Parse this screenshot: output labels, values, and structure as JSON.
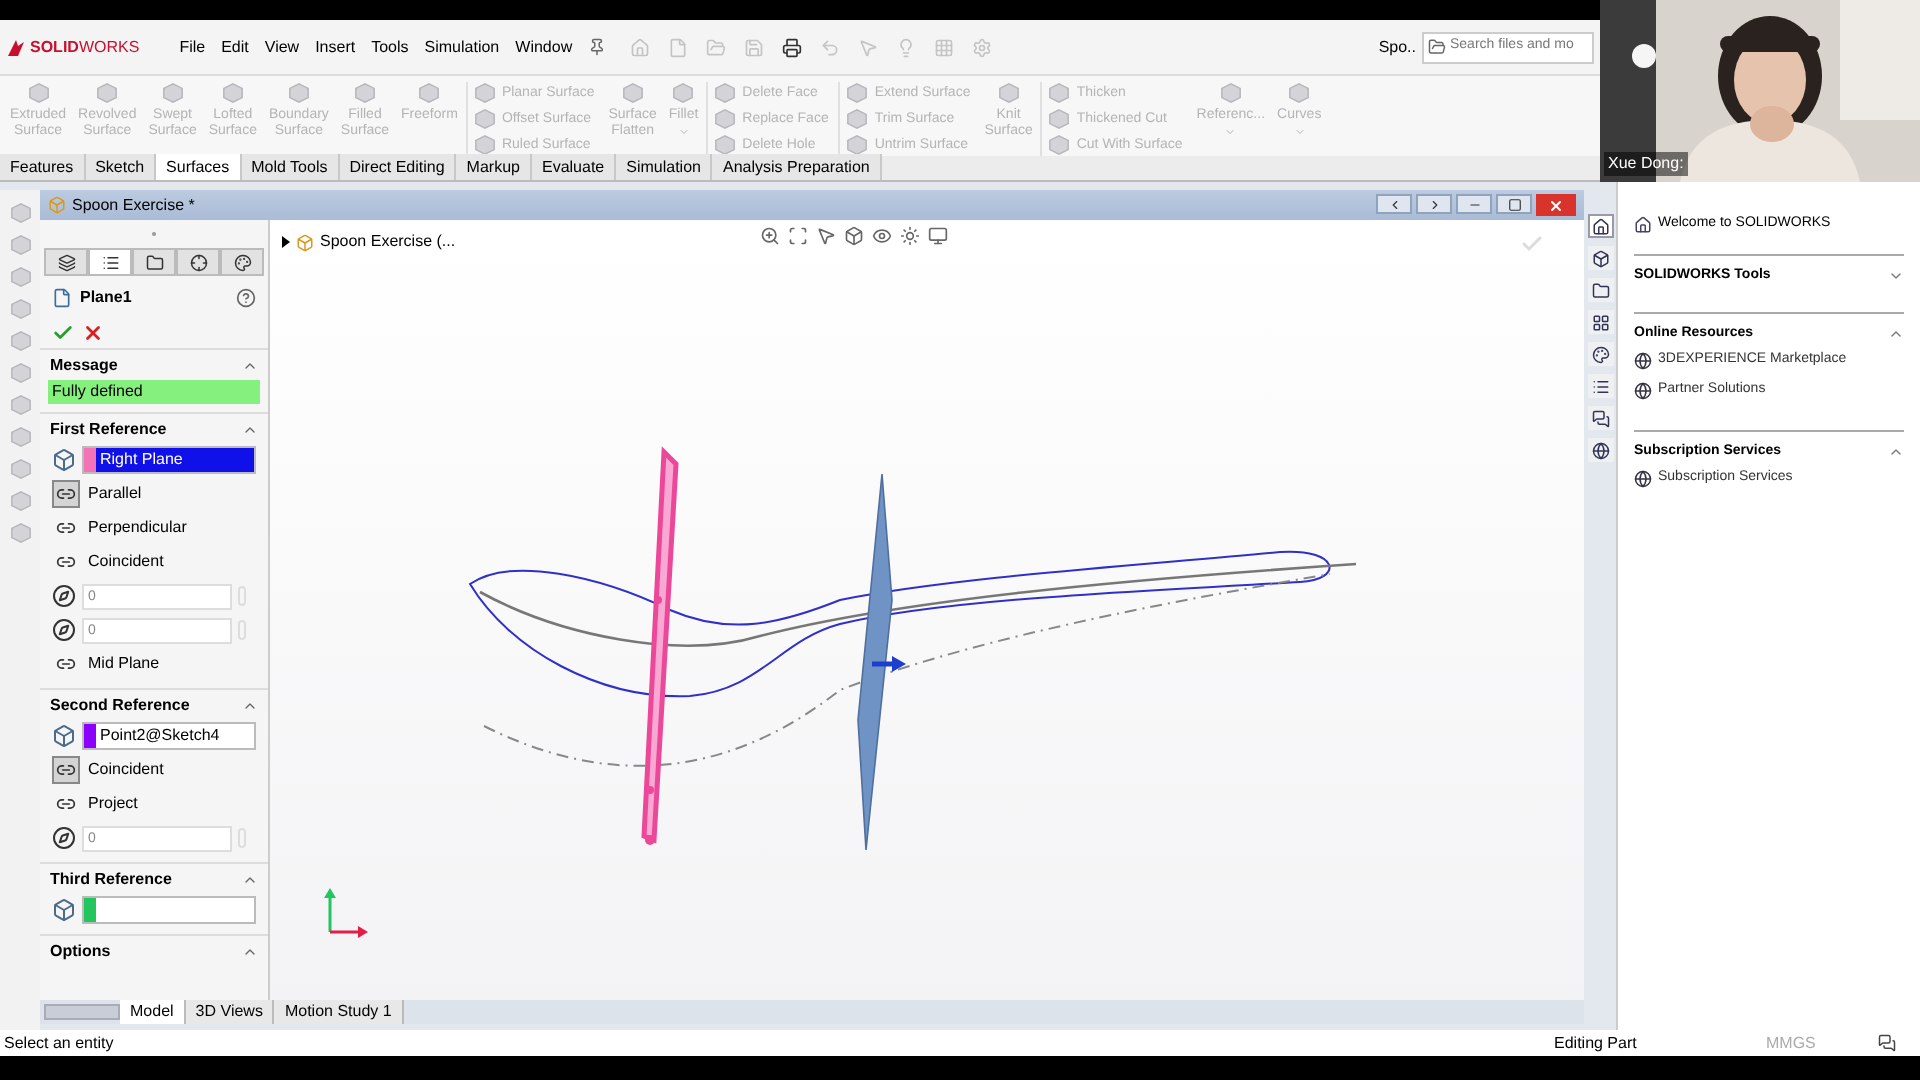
{
  "app": {
    "logo": "**SOLID**WORKS",
    "menu": [
      "File",
      "Edit",
      "View",
      "Insert",
      "Tools",
      "Simulation",
      "Window"
    ],
    "document_short": "Spo..",
    "search": {
      "placeholder": "Search files and mo"
    }
  },
  "ribbon": [
    {
      "kind": "big",
      "label": "Extruded Surface",
      "disabled": true
    },
    {
      "kind": "big",
      "label": "Revolved Surface",
      "disabled": true
    },
    {
      "kind": "big",
      "label": "Swept Surface",
      "disabled": true
    },
    {
      "kind": "big",
      "label": "Lofted Surface",
      "disabled": true
    },
    {
      "kind": "big",
      "label": "Boundary Surface",
      "disabled": true
    },
    {
      "kind": "big",
      "label": "Filled Surface",
      "disabled": true
    },
    {
      "kind": "big",
      "label": "Freeform",
      "disabled": true
    },
    {
      "kind": "stack",
      "items": [
        {
          "label": "Planar Surface",
          "disabled": true
        },
        {
          "label": "Offset Surface",
          "disabled": true
        },
        {
          "label": "Ruled Surface",
          "disabled": true
        }
      ]
    },
    {
      "kind": "big",
      "label": "Surface Flatten",
      "disabled": true
    },
    {
      "kind": "big",
      "label": "Fillet",
      "disabled": true,
      "dropdown": true
    },
    {
      "kind": "stack",
      "items": [
        {
          "label": "Delete Face",
          "disabled": true
        },
        {
          "label": "Replace Face",
          "disabled": true
        },
        {
          "label": "Delete Hole",
          "disabled": true
        }
      ]
    },
    {
      "kind": "stack",
      "items": [
        {
          "label": "Extend Surface",
          "disabled": true
        },
        {
          "label": "Trim Surface",
          "disabled": true
        },
        {
          "label": "Untrim Surface",
          "disabled": true
        }
      ]
    },
    {
      "kind": "big",
      "label": "Knit Surface",
      "disabled": true
    },
    {
      "kind": "stack",
      "items": [
        {
          "label": "Thicken",
          "disabled": true
        },
        {
          "label": "Thickened Cut",
          "disabled": true
        },
        {
          "label": "Cut With Surface",
          "disabled": true
        }
      ]
    },
    {
      "kind": "big",
      "label": "Referenc...",
      "disabled": true,
      "dropdown": true
    },
    {
      "kind": "big",
      "label": "Curves",
      "disabled": true,
      "dropdown": true
    }
  ],
  "tabs": [
    {
      "label": "Features",
      "selected": false
    },
    {
      "label": "Sketch",
      "selected": false
    },
    {
      "label": "Surfaces",
      "selected": true
    },
    {
      "label": "Mold Tools",
      "selected": false
    },
    {
      "label": "Direct Editing",
      "selected": false
    },
    {
      "label": "Markup",
      "selected": false
    },
    {
      "label": "Evaluate",
      "selected": false
    },
    {
      "label": "Simulation",
      "selected": false
    },
    {
      "label": "Analysis Preparation",
      "selected": false
    }
  ],
  "webcam": {
    "name": "Xue Dong:"
  },
  "document": {
    "title": "Spoon Exercise *",
    "tree_flyout": "Spoon Exercise (..."
  },
  "property_manager": {
    "title": "Plane1",
    "panel_tabs": [
      {
        "selected": false
      },
      {
        "selected": true
      },
      {
        "selected": false
      },
      {
        "selected": false
      },
      {
        "selected": false
      }
    ],
    "sections": [
      {
        "title": "Message",
        "expanded": true,
        "rows": [
          {
            "kind": "message",
            "text": "Fully defined"
          }
        ]
      },
      {
        "title": "First Reference",
        "expanded": true,
        "rows": [
          {
            "kind": "selection",
            "value": "Right Plane",
            "color": "#f472b6",
            "highlighted": true
          },
          {
            "kind": "option",
            "label": "Parallel",
            "selected": true
          },
          {
            "kind": "option",
            "label": "Perpendicular",
            "selected": false
          },
          {
            "kind": "option",
            "label": "Coincident",
            "selected": false
          },
          {
            "kind": "number",
            "value": "0"
          },
          {
            "kind": "number",
            "value": "0"
          },
          {
            "kind": "option",
            "label": "Mid Plane",
            "selected": false
          }
        ]
      },
      {
        "title": "Second Reference",
        "expanded": true,
        "rows": [
          {
            "kind": "selection",
            "value": "Point2@Sketch4",
            "color": "#8b00ff",
            "highlighted": false
          },
          {
            "kind": "option",
            "label": "Coincident",
            "selected": true
          },
          {
            "kind": "option",
            "label": "Project",
            "selected": false
          },
          {
            "kind": "number",
            "value": "0"
          }
        ]
      },
      {
        "title": "Third Reference",
        "expanded": true,
        "rows": [
          {
            "kind": "selection",
            "color": "#22c55e",
            "highlighted": false
          }
        ]
      },
      {
        "title": "Options",
        "expanded": true
      }
    ]
  },
  "bottom_tabs": [
    {
      "label": "Model",
      "selected": true
    },
    {
      "label": "3D Views",
      "selected": false
    },
    {
      "label": "Motion Study 1",
      "selected": false
    }
  ],
  "task_pane": {
    "tabs": [
      {
        "selected": true
      },
      {
        "selected": false
      },
      {
        "selected": false
      },
      {
        "selected": false
      },
      {
        "selected": false
      },
      {
        "selected": false
      },
      {
        "selected": false
      },
      {
        "selected": false
      }
    ],
    "welcome": "Welcome to SOLIDWORKS",
    "sections": [
      {
        "title": "SOLIDWORKS Tools",
        "expanded": false
      },
      {
        "title": "Online Resources",
        "expanded": true,
        "items": [
          "3DEXPERIENCE Marketplace",
          "Partner Solutions"
        ]
      },
      {
        "title": "Subscription Services",
        "expanded": true,
        "items": [
          "Subscription Services"
        ]
      }
    ]
  },
  "status_bar": {
    "message": "Select an entity",
    "mode": "Editing Part",
    "units": "MMGS"
  }
}
